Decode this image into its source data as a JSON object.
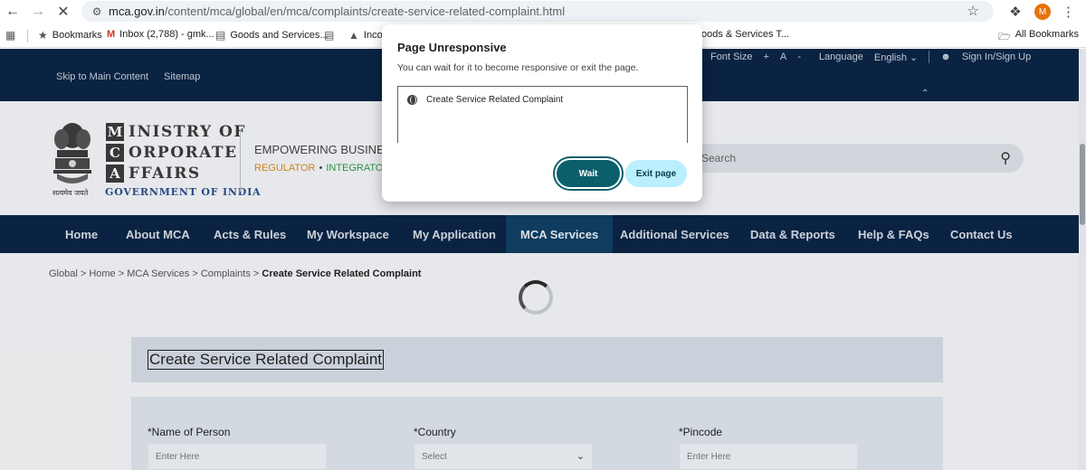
{
  "browser": {
    "url_host": "mca.gov.in",
    "url_path": "/content/mca/global/en/mca/complaints/create-service-related-complaint.html",
    "avatar_letter": "M",
    "bookmarks": [
      {
        "label": "Bookmarks"
      },
      {
        "label": "Inbox (2,788) - gmk..."
      },
      {
        "label": "Goods and Services..."
      },
      {
        "label": "Incor"
      },
      {
        "label": "oods & Services T..."
      }
    ],
    "all_bookmarks": "All Bookmarks"
  },
  "topbar": {
    "skip": "Skip to Main Content",
    "sitemap": "Sitemap",
    "font_size": "Font Size",
    "font_plus": "+",
    "font_a": "A",
    "font_minus": "-",
    "language_label": "Language",
    "language_value": "English",
    "sign_in": "Sign In/Sign Up"
  },
  "header": {
    "emblem_caption": "सत्यमेव जयते",
    "logo_lines": [
      {
        "letter": "M",
        "rest": "INISTRY OF"
      },
      {
        "letter": "C",
        "rest": "ORPORATE"
      },
      {
        "letter": "A",
        "rest": "FFAIRS"
      }
    ],
    "government": "GOVERNMENT OF INDIA",
    "tagline": "EMPOWERING BUSINESS",
    "regulator": "REGULATOR",
    "dot": "•",
    "integrator": "INTEGRATOR",
    "search_placeholder": "Search"
  },
  "nav": {
    "items": [
      {
        "label": "Home"
      },
      {
        "label": "About MCA"
      },
      {
        "label": "Acts & Rules"
      },
      {
        "label": "My Workspace"
      },
      {
        "label": "My Application"
      },
      {
        "label": "MCA Services"
      },
      {
        "label": "Additional Services"
      },
      {
        "label": "Data & Reports"
      },
      {
        "label": "Help & FAQs"
      },
      {
        "label": "Contact Us"
      }
    ],
    "active": "MCA Services"
  },
  "breadcrumb": {
    "trail": "Global > Home > MCA Services > Complaints >",
    "current": "Create Service Related Complaint"
  },
  "page_title": "Create Service Related Complaint",
  "form": {
    "fields": [
      {
        "label": "*Name of Person",
        "placeholder": "Enter Here"
      },
      {
        "label": "*Country",
        "placeholder": "Select"
      },
      {
        "label": "*Pincode",
        "placeholder": "Enter Here"
      }
    ]
  },
  "dialog": {
    "title": "Page Unresponsive",
    "message": "You can wait for it to become responsive or exit the page.",
    "page_entry": "Create Service Related Complaint",
    "wait_label": "Wait",
    "exit_label": "Exit page"
  },
  "icons": {
    "back": "arrow-left-icon",
    "forward": "arrow-right-icon",
    "stop": "close-icon",
    "site_info": "tune-icon",
    "bookmark_star": "star-icon",
    "extensions": "puzzle-icon",
    "menu": "kebab-icon",
    "apps": "grid-icon",
    "search": "search-icon",
    "user": "user-icon",
    "globe": "globe-icon",
    "chevron": "chevron-down-icon"
  },
  "colors": {
    "nav_bg": "#0b2546",
    "nav_active": "#104065",
    "wait_button": "#0b5f6b",
    "exit_button": "#b9efff"
  }
}
